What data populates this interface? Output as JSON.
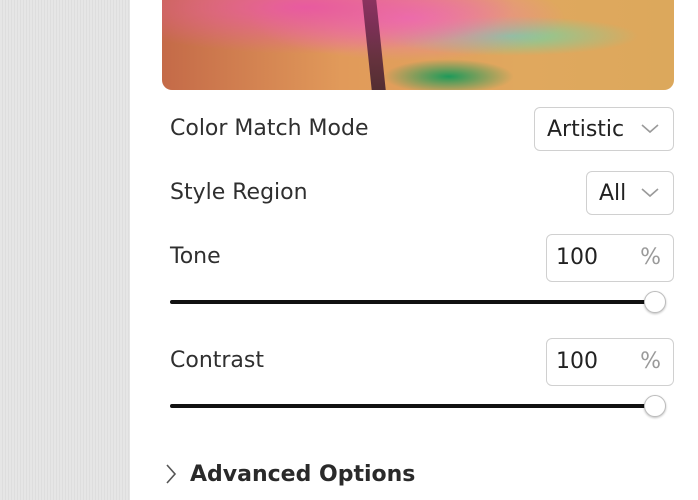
{
  "options": {
    "color_match_mode": {
      "label": "Color Match Mode",
      "value": "Artistic"
    },
    "style_region": {
      "label": "Style Region",
      "value": "All"
    },
    "tone": {
      "label": "Tone",
      "value": "100",
      "unit": "%",
      "slider_level": 1.0
    },
    "contrast": {
      "label": "Contrast",
      "value": "100",
      "unit": "%",
      "slider_level": 1.0
    }
  },
  "advanced": {
    "label": "Advanced Options"
  },
  "icons": {
    "dropdown": "chevron-down-icon",
    "expander": "chevron-right-icon"
  },
  "colors": {
    "track": "#111111",
    "border": "#d0d0d0",
    "text": "#2f2f2f"
  }
}
